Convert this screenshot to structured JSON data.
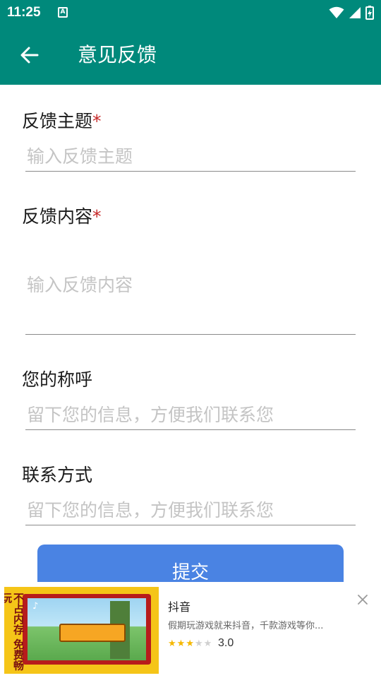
{
  "status_bar": {
    "time": "11:25",
    "notification_letter": "A"
  },
  "app_bar": {
    "title": "意见反馈",
    "back_icon": "arrow-left-icon"
  },
  "form": {
    "subject": {
      "label": "反馈主题",
      "required_mark": "*",
      "placeholder": "输入反馈主题"
    },
    "content": {
      "label": "反馈内容",
      "required_mark": "*",
      "placeholder": "输入反馈内容"
    },
    "name": {
      "label": "您的称呼",
      "placeholder": "留下您的信息，方便我们联系您"
    },
    "contact": {
      "label": "联系方式",
      "placeholder": "留下您的信息，方便我们联系您"
    },
    "submit_label": "提交"
  },
  "ad": {
    "title": "抖音",
    "description": "假期玩游戏就来抖音，千款游戏等你...",
    "rating": "3.0",
    "rating_value": 3,
    "rating_max": 5,
    "thumb_text": "不占内存 免费畅玩"
  },
  "colors": {
    "primary": "#00897b",
    "required": "#c62828",
    "button": "#4a83e3",
    "star_filled": "#f5b800",
    "star_empty": "#d0d0d0"
  }
}
